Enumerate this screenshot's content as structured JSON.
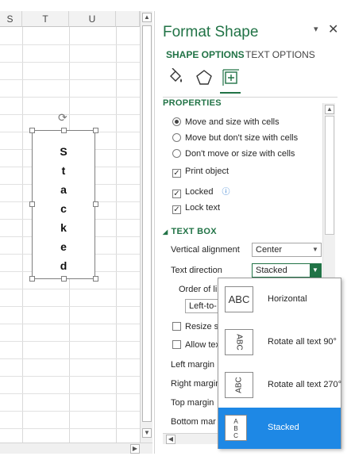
{
  "sheet": {
    "columns": [
      "S",
      "T",
      "U"
    ],
    "shape_letters": [
      "S",
      "t",
      "a",
      "c",
      "k",
      "e",
      "d"
    ]
  },
  "pane": {
    "title": "Format Shape",
    "options_arrow": "▾",
    "close": "✕",
    "tabs": [
      "SHAPE OPTIONS",
      "TEXT OPTIONS"
    ],
    "active_tab": "SHAPE OPTIONS",
    "category_icons": [
      "fill-line-icon",
      "effects-icon",
      "size-properties-icon"
    ],
    "properties_section": "PROPERTIES",
    "radio_options": [
      {
        "label": "Move and size with cells",
        "checked": true
      },
      {
        "label": "Move but don't size with cells",
        "checked": false
      },
      {
        "label": "Don't move or size with cells",
        "checked": false
      }
    ],
    "check_options": [
      {
        "label": "Print object",
        "checked": true
      },
      {
        "label": "Locked",
        "checked": true
      },
      {
        "label": "Lock text",
        "checked": true
      }
    ],
    "info_icon": "ⓘ",
    "text_box_section": "TEXT BOX",
    "vertical_alignment": {
      "label": "Vertical alignment",
      "value": "Center"
    },
    "text_direction": {
      "label": "Text direction",
      "value": "Stacked"
    },
    "order_of_lines": {
      "label": "Order of lin",
      "value": "Left-to-"
    },
    "resize_label": "Resize sh",
    "allow_label": "Allow tex",
    "margins": [
      "Left margin",
      "Right margin",
      "Top margin",
      "Bottom mar"
    ]
  },
  "flyout": {
    "items": [
      {
        "label": "Horizontal",
        "icon": "ABC",
        "selected": false
      },
      {
        "label": "Rotate all text 90°",
        "icon": "ABC",
        "selected": false
      },
      {
        "label": "Rotate all text 270°",
        "icon": "ABC",
        "selected": false
      },
      {
        "label": "Stacked",
        "icon": "A B C",
        "selected": true
      }
    ]
  },
  "colors": {
    "accent": "#217346",
    "selection": "#1e88e5"
  }
}
